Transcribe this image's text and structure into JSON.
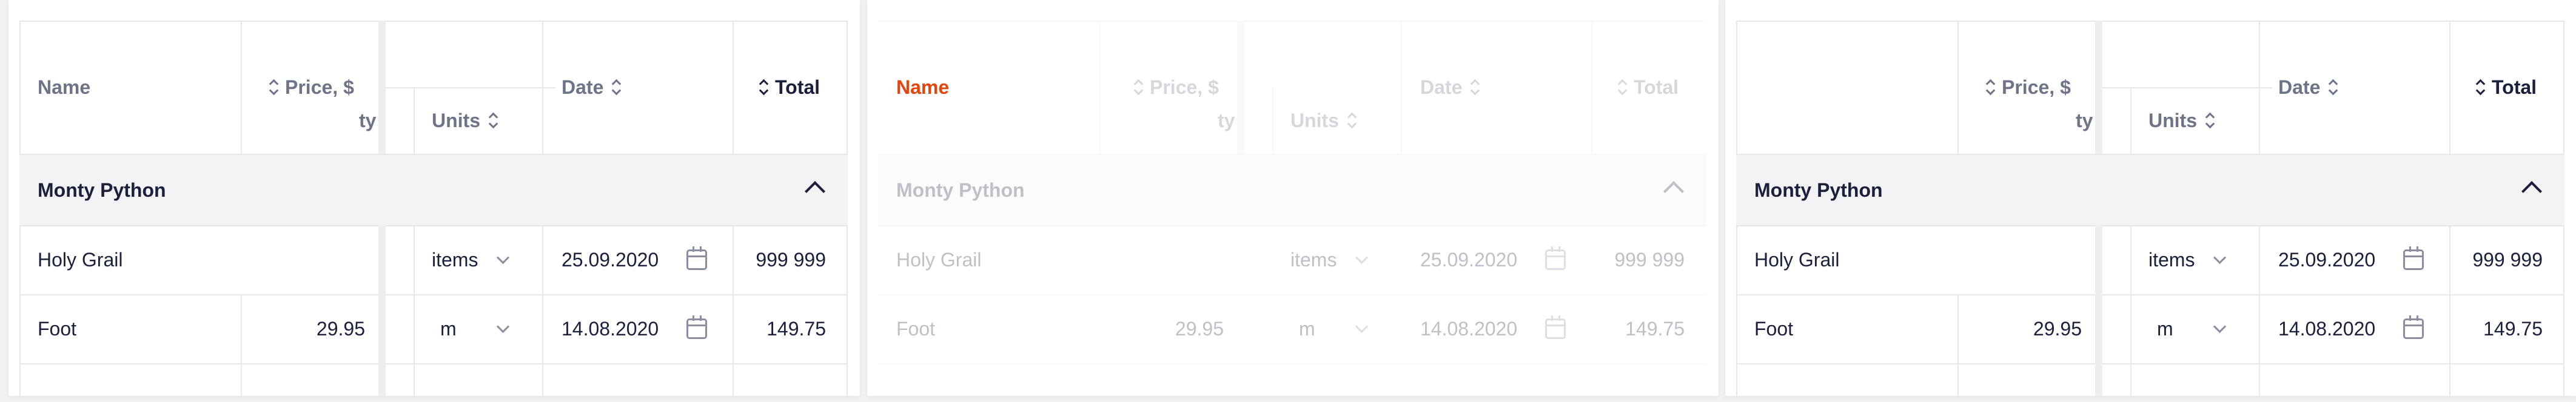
{
  "columns": {
    "name": "Name",
    "price": "Price, $",
    "partial": "ty",
    "units": "Units",
    "date": "Date",
    "total": "Total"
  },
  "group": {
    "label": "Monty Python"
  },
  "rows": [
    {
      "name": "Holy Grail",
      "price": "",
      "units": "items",
      "date": "25.09.2020",
      "total": "999 999"
    },
    {
      "name": "Foot",
      "price": "29.95",
      "units": "m",
      "date": "14.08.2020",
      "total": "149.75"
    }
  ],
  "colors": {
    "accent": "#e8440a",
    "header_text": "#6e7387",
    "text": "#1b1f3b"
  },
  "icons": [
    "sort-icon",
    "chevron-up-icon",
    "chevron-down-icon",
    "calendar-icon"
  ]
}
